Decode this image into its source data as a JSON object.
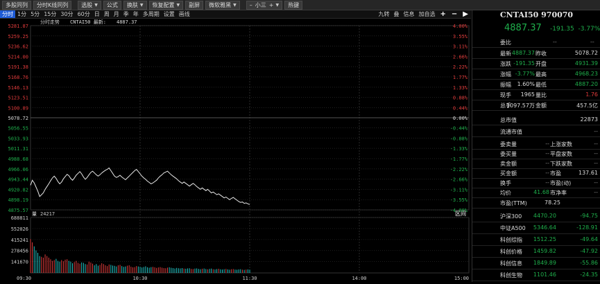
{
  "toolbar": {
    "items": [
      {
        "label": "多股同列",
        "caret": false
      },
      {
        "label": "分时K线同列",
        "caret": false
      },
      {
        "label": "选股",
        "caret": true
      },
      {
        "label": "公式",
        "caret": false
      },
      {
        "label": "换肤",
        "caret": true
      },
      {
        "label": "恢复配置",
        "caret": true
      },
      {
        "label": "副屏",
        "caret": false
      },
      {
        "label": "微软雅黑",
        "caret": true
      },
      {
        "label": "小三",
        "caret": true,
        "prefix": "–",
        "suffix": "+"
      },
      {
        "label": "热键",
        "caret": false
      }
    ]
  },
  "periods": [
    "分时",
    "1分",
    "5分",
    "15分",
    "30分",
    "60分",
    "日",
    "周",
    "月",
    "季",
    "年",
    "多周期",
    "设置",
    "画线"
  ],
  "active_period": "分时",
  "chart_tools": [
    "九转",
    "叠",
    "信息",
    "加自选",
    "+",
    "−",
    "▶"
  ],
  "chart_header": {
    "prefix": "分时走势",
    "name": "CNTAI50",
    "latest_label": "最新:",
    "latest": "4887.37"
  },
  "volume_header": {
    "prefix": "量",
    "value": "24217",
    "tool": "区间"
  },
  "panel": {
    "title": "CNTAI50 970070",
    "price": "4887.37",
    "change": "-191.35",
    "pct": "-3.77%",
    "weibi_label": "委比",
    "weibi_val": "--",
    "weicha_label": "--",
    "rows": [
      {
        "l1": "最新",
        "v1": "4887.37",
        "c1": "g",
        "l2": "昨收",
        "v2": "5078.72",
        "c2": "w"
      },
      {
        "l1": "涨跌",
        "v1": "-191.35",
        "c1": "g",
        "l2": "开盘",
        "v2": "4931.39",
        "c2": "g"
      },
      {
        "l1": "涨幅",
        "v1": "-3.77%",
        "c1": "g",
        "l2": "最高",
        "v2": "4968.23",
        "c2": "g"
      },
      {
        "l1": "振幅",
        "v1": "1.60%",
        "c1": "w",
        "l2": "最低",
        "v2": "4887.20",
        "c2": "g"
      },
      {
        "l1": "现手",
        "v1": "1965",
        "c1": "w",
        "l2": "量比",
        "v2": "1.76",
        "c2": "r"
      },
      {
        "l1": "总手",
        "v1": "1097.57万",
        "c1": "w",
        "l2": "金额",
        "v2": "457.5亿",
        "c2": "w"
      }
    ],
    "zongshizhi_label": "总市值",
    "zongshizhi_val": "22873",
    "liutong_label": "流通市值",
    "liutong_val": "--",
    "stats": [
      {
        "l1": "委卖量",
        "v1": "--",
        "l2": "上涨家数",
        "v2": "--"
      },
      {
        "l1": "委买量",
        "v1": "--",
        "l2": "平盘家数",
        "v2": "--"
      },
      {
        "l1": "卖金额",
        "v1": "--",
        "l2": "下跌家数",
        "v2": "--"
      },
      {
        "l1": "买金额",
        "v1": "--",
        "l2": "市盈",
        "v2": "137.61"
      },
      {
        "l1": "换手",
        "v1": "--",
        "l2": "市盈(动)",
        "v2": "--"
      },
      {
        "l1": "均价",
        "v1": "41.68",
        "l2": "市净率",
        "v2": "--"
      }
    ],
    "pe_ttm_label": "市盈(TTM)",
    "pe_ttm_val": "78.25",
    "indices": [
      {
        "name": "沪深300",
        "val": "4470.20",
        "chg": "-94.75"
      },
      {
        "name": "中证A500",
        "val": "5346.64",
        "chg": "-128.91"
      },
      {
        "name": "科创综指",
        "val": "1512.25",
        "chg": "-49.64"
      },
      {
        "name": "科创价格",
        "val": "1459.82",
        "chg": "-47.92"
      },
      {
        "name": "科创信息",
        "val": "1849.89",
        "chg": "-55.86"
      },
      {
        "name": "科创生物",
        "val": "1101.46",
        "chg": "-24.35"
      }
    ]
  },
  "chart_data": {
    "type": "line",
    "prev_close": "5078.72",
    "y_labels_up": [
      "5281.87",
      "5259.25",
      "5236.62",
      "5214.00",
      "5191.38",
      "5168.76",
      "5146.13",
      "5123.51",
      "5100.89"
    ],
    "pct_labels_up": [
      "4.00%",
      "3.55%",
      "3.11%",
      "2.66%",
      "2.22%",
      "1.77%",
      "1.33%",
      "0.88%",
      "0.44%"
    ],
    "y_labels_zero": "5078.72",
    "pct_label_zero": "0.00%",
    "y_labels_down": [
      "5056.55",
      "5033.93",
      "5011.31",
      "4988.68",
      "4966.06",
      "4943.44",
      "4920.82",
      "4898.19",
      "4875.57"
    ],
    "pct_labels_down": [
      "-0.44%",
      "-0.88%",
      "-1.33%",
      "-1.77%",
      "-2.22%",
      "-2.66%",
      "-3.11%",
      "-3.55%",
      "-4.00%"
    ],
    "ylim": [
      4875.57,
      5281.87
    ],
    "time_labels": [
      "09:30",
      "10:30",
      "11:30",
      "14:00",
      "15:00"
    ],
    "volume_labels": [
      "688811",
      "552026",
      "415241",
      "278456",
      "141670"
    ],
    "volume_max": 688811,
    "series": [
      {
        "values": [
          4930,
          4941,
          4935,
          4926,
          4917,
          4905,
          4909,
          4913,
          4921,
          4927,
          4933,
          4940,
          4946,
          4950,
          4945,
          4938,
          4933,
          4937,
          4944,
          4949,
          4954,
          4951,
          4945,
          4941,
          4946,
          4952,
          4956,
          4960,
          4955,
          4948,
          4943,
          4947,
          4953,
          4958,
          4961,
          4957,
          4953,
          4950,
          4953,
          4957,
          4960,
          4963,
          4965,
          4968,
          4962,
          4956,
          4950,
          4947,
          4949,
          4952,
          4948,
          4945,
          4942,
          4946,
          4950,
          4954,
          4958,
          4962,
          4965,
          4960,
          4955,
          4950,
          4946,
          4943,
          4939,
          4936,
          4933,
          4935,
          4938,
          4941,
          4946,
          4950,
          4953,
          4957,
          4959,
          4961,
          4957,
          4953,
          4950,
          4947,
          4944,
          4940,
          4937,
          4934,
          4937,
          4934,
          4931,
          4928,
          4931,
          4934,
          4931,
          4927,
          4924,
          4921,
          4924,
          4921,
          4918,
          4921,
          4917,
          4913,
          4915,
          4912,
          4909,
          4911,
          4908,
          4905,
          4902,
          4904,
          4901,
          4898,
          4901,
          4903,
          4900,
          4897,
          4894,
          4892,
          4893,
          4890,
          4891,
          4889,
          4887.4
        ]
      }
    ],
    "volumes": [
      420000,
      380000,
      330000,
      280000,
      250000,
      210000,
      200000,
      190000,
      230000,
      210000,
      190000,
      170000,
      150000,
      160000,
      175000,
      150000,
      140000,
      160000,
      145000,
      165000,
      170000,
      150000,
      140000,
      120000,
      135000,
      150000,
      125000,
      115000,
      130000,
      125000,
      110000,
      105000,
      140000,
      130000,
      115000,
      95000,
      110000,
      90000,
      100000,
      120000,
      110000,
      95000,
      85000,
      105000,
      100000,
      92000,
      88000,
      80000,
      95000,
      100000,
      85000,
      75000,
      80000,
      90000,
      95000,
      78000,
      70000,
      72000,
      85000,
      80000,
      76000,
      68000,
      74000,
      82000,
      70000,
      65000,
      72000,
      75000,
      70000,
      62000,
      68000,
      72000,
      65000,
      60000,
      58000,
      66000,
      70000,
      64000,
      60000,
      55000,
      62000,
      58000,
      56000,
      60000,
      54000,
      52000,
      56000,
      58000,
      50000,
      48000,
      54000,
      56000,
      50000,
      46000,
      52000,
      55000,
      48000,
      45000,
      50000,
      54000,
      46000,
      44000,
      48000,
      52000,
      45000,
      42000,
      46000,
      50000,
      44000,
      40000,
      46000,
      48000,
      42000,
      40000,
      44000,
      46000,
      40000,
      38000,
      42000,
      44000,
      40000
    ]
  }
}
